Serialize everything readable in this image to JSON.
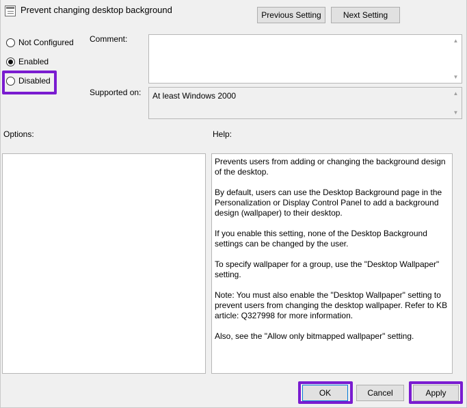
{
  "header": {
    "title": "Prevent changing desktop background",
    "previous_label": "Previous Setting",
    "next_label": "Next Setting"
  },
  "state": {
    "options": [
      {
        "label": "Not Configured",
        "checked": false
      },
      {
        "label": "Enabled",
        "checked": true
      },
      {
        "label": "Disabled",
        "checked": false
      }
    ]
  },
  "comment": {
    "label": "Comment:",
    "value": ""
  },
  "supported": {
    "label": "Supported on:",
    "value": "At least Windows 2000"
  },
  "options_panel": {
    "label": "Options:"
  },
  "help": {
    "label": "Help:",
    "paragraphs": [
      "Prevents users from adding or changing the background design of the desktop.",
      "By default, users can use the Desktop Background page in the Personalization or Display Control Panel to add a background design (wallpaper) to their desktop.",
      "If you enable this setting, none of the Desktop Background settings can be changed by the user.",
      "To specify wallpaper for a group, use the \"Desktop Wallpaper\" setting.",
      "Note: You must also enable the \"Desktop Wallpaper\" setting to prevent users from changing the desktop wallpaper. Refer to KB article: Q327998 for more information.",
      "Also, see the \"Allow only bitmapped wallpaper\" setting."
    ]
  },
  "footer": {
    "ok_label": "OK",
    "cancel_label": "Cancel",
    "apply_label": "Apply"
  },
  "colors": {
    "highlight": "#7a1cd0",
    "dialog_bg": "#f0f0f0"
  }
}
